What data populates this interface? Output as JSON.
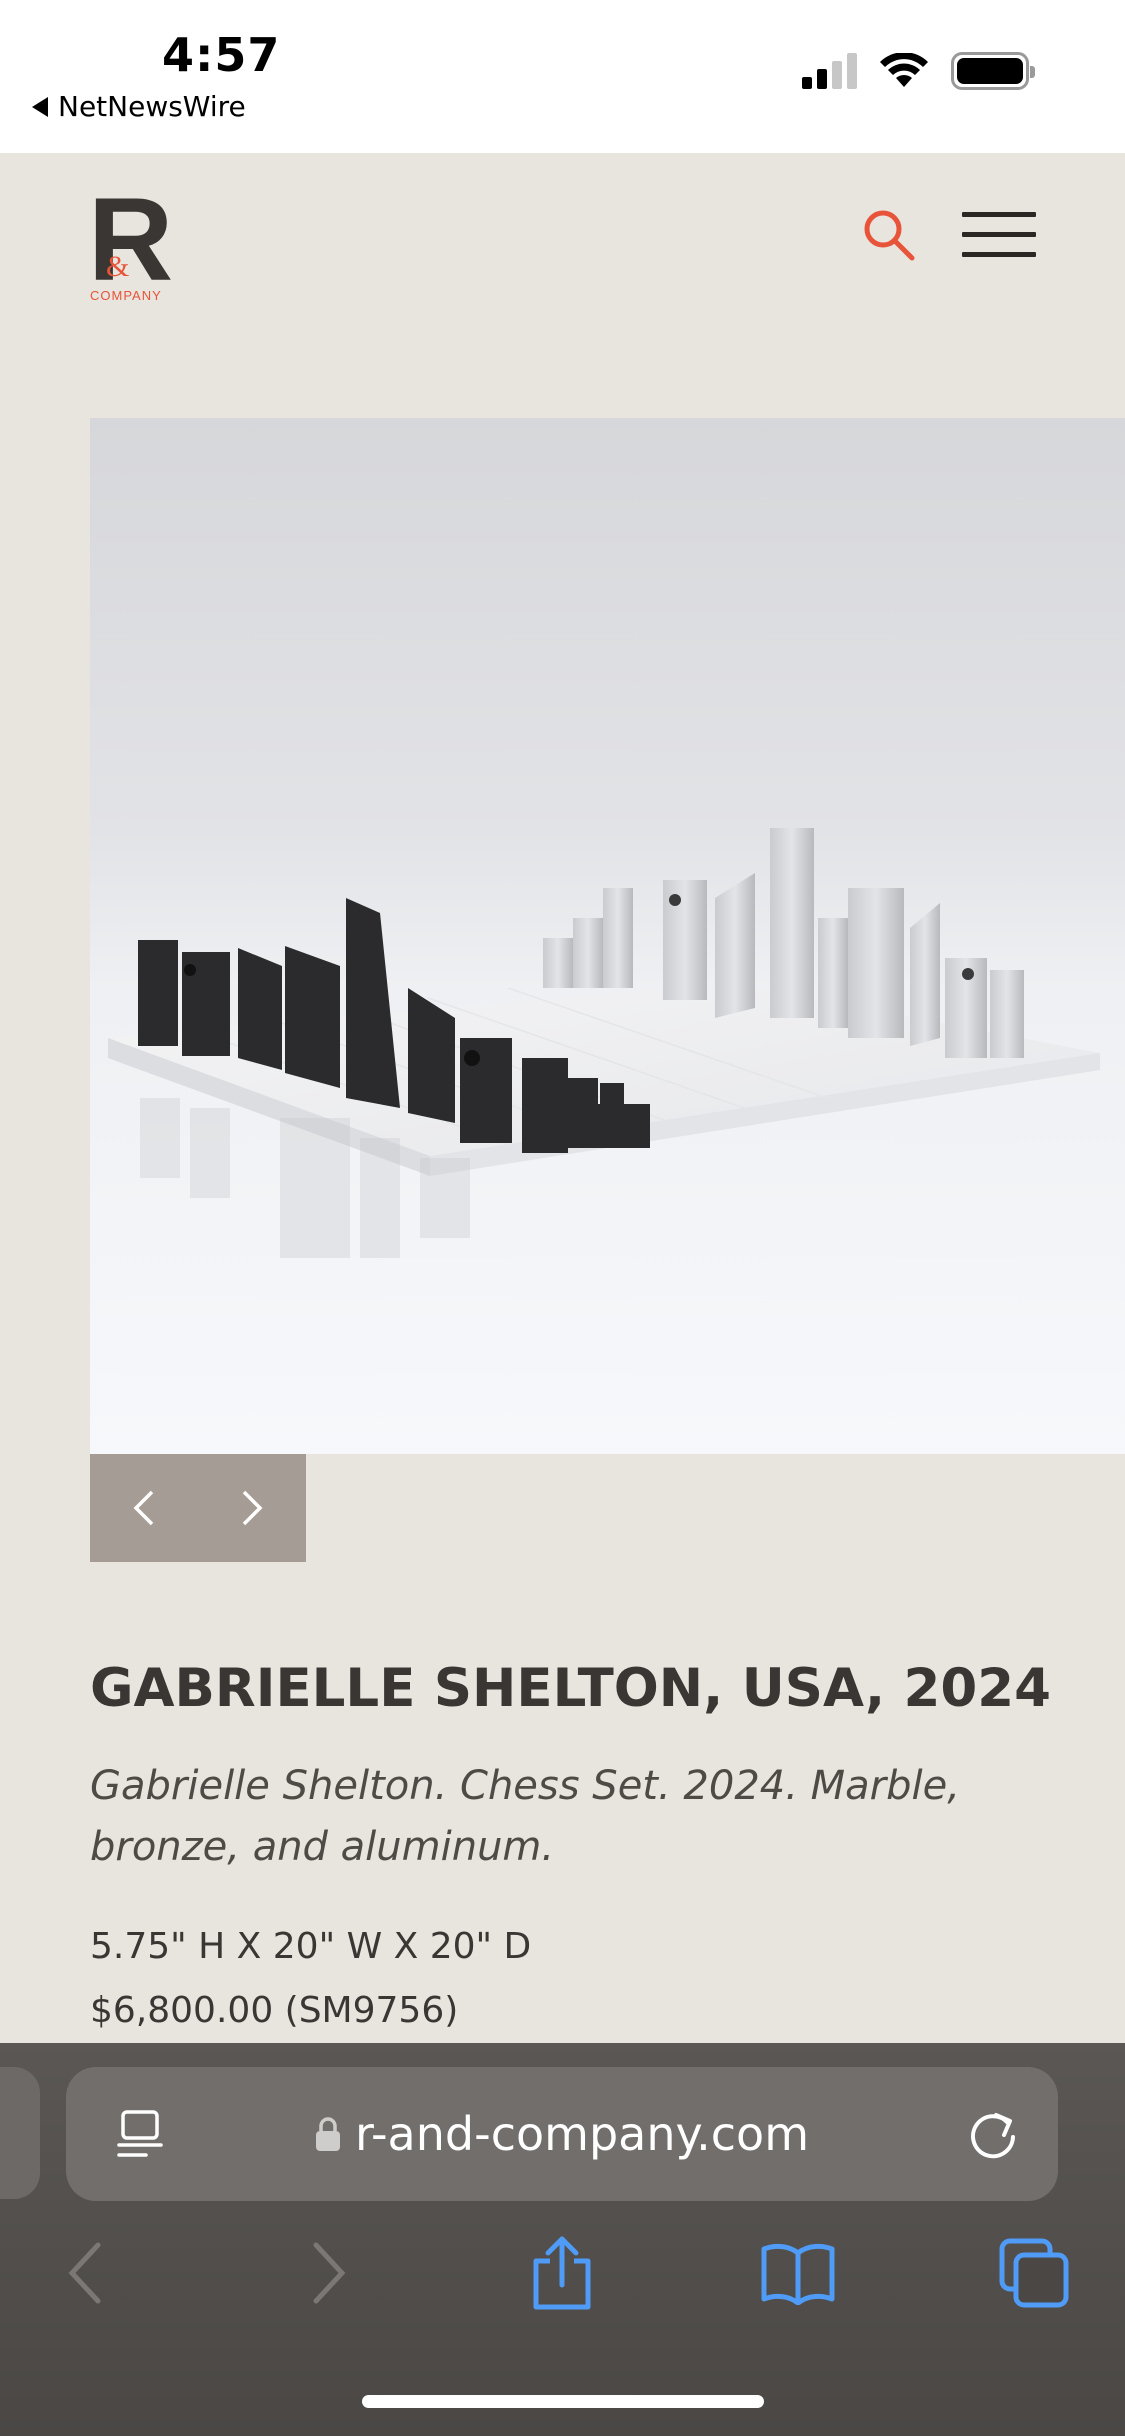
{
  "status_bar": {
    "time": "4:57",
    "back_app": "NetNewsWire"
  },
  "site": {
    "logo_letter": "R",
    "logo_ampersand": "&",
    "logo_company": "COMPANY",
    "accent_color": "#e8543a"
  },
  "product": {
    "title": "GABRIELLE SHELTON, USA, 2024",
    "caption": "Gabrielle Shelton. Chess Set. 2024. Marble, bronze, and aluminum.",
    "dimensions": "5.75\" H X 20\" W X 20\" D",
    "price": "$6,800.00 (SM9756)"
  },
  "browser": {
    "url": "r-and-company.com"
  }
}
